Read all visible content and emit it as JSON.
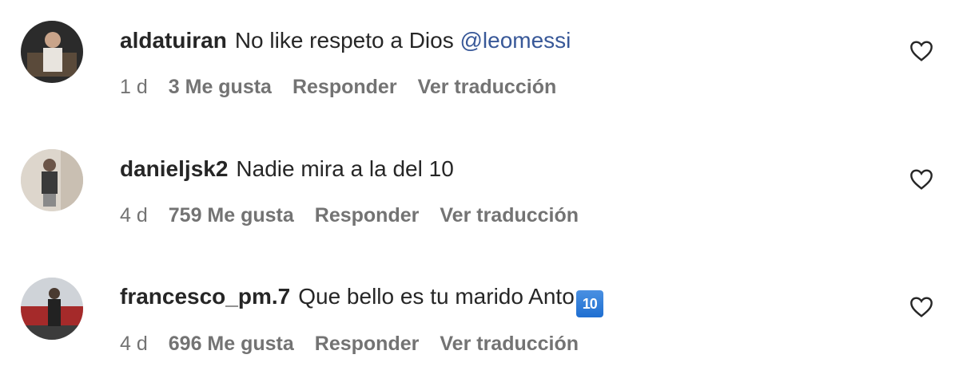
{
  "comments": [
    {
      "username": "aldatuiran",
      "text": "No like respeto a Dios",
      "mention": "@leomessi",
      "time": "1 d",
      "likes": "3 Me gusta",
      "reply": "Responder",
      "translate": "Ver traducción",
      "icon": "heart-icon"
    },
    {
      "username": "danieljsk2",
      "text": "Nadie mira a la del 10",
      "time": "4 d",
      "likes": "759 Me gusta",
      "reply": "Responder",
      "translate": "Ver traducción",
      "icon": "heart-icon"
    },
    {
      "username": "francesco_pm.7",
      "text": "Que bello es tu marido Anto",
      "emoji": "10",
      "time": "4 d",
      "likes": "696 Me gusta",
      "reply": "Responder",
      "translate": "Ver traducción",
      "icon": "heart-icon"
    }
  ],
  "colors": {
    "text": "#262626",
    "meta": "#737373",
    "mention": "#385898"
  }
}
